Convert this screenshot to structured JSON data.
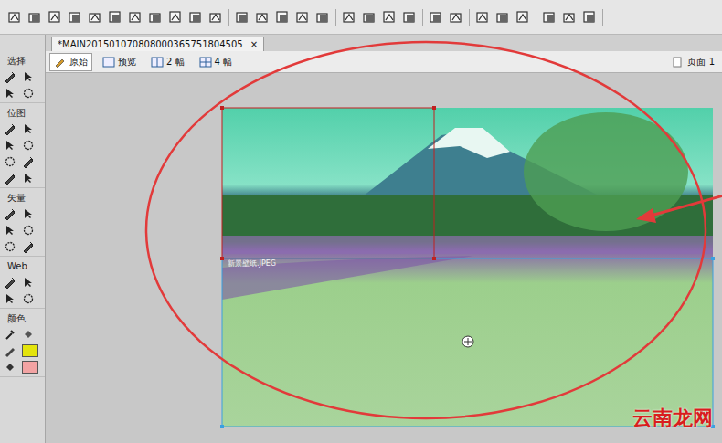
{
  "document_tab": {
    "title": "*MAIN201501070808000365751804505",
    "close": "×"
  },
  "view_tabs": [
    {
      "label": "原始",
      "selected": true
    },
    {
      "label": "预览",
      "selected": false
    },
    {
      "label": "2 幅",
      "selected": false
    },
    {
      "label": "4 幅",
      "selected": false
    }
  ],
  "page": {
    "label": "页面 1"
  },
  "tool_sections": [
    {
      "label": "选择"
    },
    {
      "label": "位图"
    },
    {
      "label": "矢量"
    },
    {
      "label": "Web"
    },
    {
      "label": "颜色"
    }
  ],
  "colors": {
    "stroke": "#e4e40c",
    "fill": "#f2a3a3"
  },
  "canvas": {
    "slice_label": "新景壁纸.JPEG",
    "annotation_color": "#e23a3a"
  },
  "watermark": {
    "text": "云南龙网"
  }
}
